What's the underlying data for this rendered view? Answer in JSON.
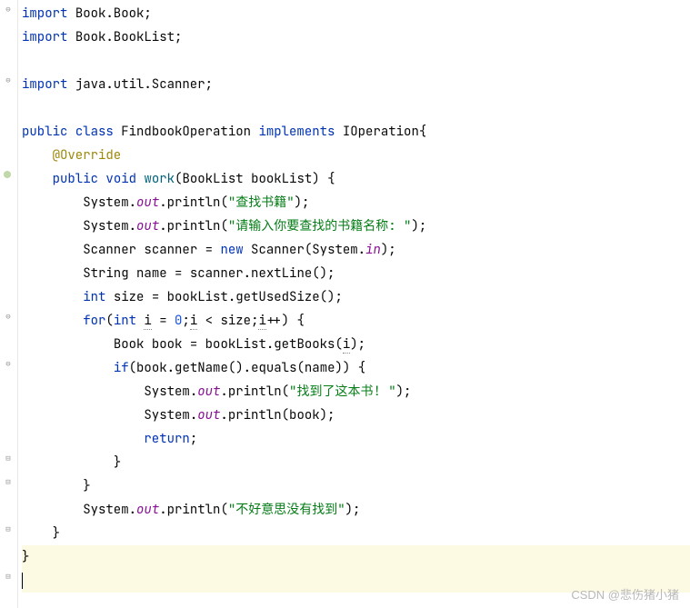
{
  "code": {
    "l1": {
      "import": "import",
      "pkg": "Book.Book",
      "semi": ";"
    },
    "l2": {
      "import": "import",
      "pkg": "Book.BookList",
      "semi": ";"
    },
    "l4": {
      "import": "import",
      "pkg": "java.util.Scanner",
      "semi": ";"
    },
    "l6": {
      "public": "public",
      "class": "class",
      "name": "FindbookOperation",
      "implements": "implements",
      "iface": "IOperation",
      "brace": "{"
    },
    "l7": {
      "ann": "@Override"
    },
    "l8": {
      "public": "public",
      "void": "void",
      "method": "work",
      "lparen": "(",
      "type": "BookList",
      "param": "bookList",
      "rparen": ") {"
    },
    "l9": {
      "sys": "System",
      "dot1": ".",
      "out": "out",
      "dot2": ".",
      "println": "println",
      "lp": "(",
      "str": "\"查找书籍\"",
      "rp": ");"
    },
    "l10": {
      "sys": "System",
      "dot1": ".",
      "out": "out",
      "dot2": ".",
      "println": "println",
      "lp": "(",
      "str": "\"请输入你要查找的书籍名称: \"",
      "rp": ");"
    },
    "l11": {
      "type": "Scanner",
      "var": "scanner",
      "eq": " = ",
      "new": "new",
      "ctor": "Scanner",
      "lp": "(",
      "sys": "System",
      "dot": ".",
      "in": "in",
      "rp": ");"
    },
    "l12": {
      "type": "String",
      "var": "name",
      "eq": " = ",
      "obj": "scanner",
      "dot": ".",
      "method": "nextLine",
      "call": "();"
    },
    "l13": {
      "int": "int",
      "var": "size",
      "eq": " = ",
      "obj": "bookList",
      "dot": ".",
      "method": "getUsedSize",
      "call": "();"
    },
    "l14": {
      "for": "for",
      "lp": "(",
      "int": "int",
      "i1": "i",
      "eq": " = ",
      "zero": "0",
      "semi1": ";",
      "i2": "i",
      "lt": " < ",
      "size": "size",
      "semi2": ";",
      "i3": "i",
      "inc": "++) {"
    },
    "l15": {
      "type": "Book",
      "var": "book",
      "eq": " = ",
      "obj": "bookList",
      "dot": ".",
      "method": "getBooks",
      "lp": "(",
      "i": "i",
      "rp": ");"
    },
    "l16": {
      "if": "if",
      "lp": "(",
      "obj": "book",
      "dot1": ".",
      "m1": "getName",
      "call1": "()",
      "dot2": ".",
      "m2": "equals",
      "lp2": "(",
      "arg": "name",
      "rp": ")) {"
    },
    "l17": {
      "sys": "System",
      "dot1": ".",
      "out": "out",
      "dot2": ".",
      "println": "println",
      "lp": "(",
      "str": "\"找到了这本书! \"",
      "rp": ");"
    },
    "l18": {
      "sys": "System",
      "dot1": ".",
      "out": "out",
      "dot2": ".",
      "println": "println",
      "lp": "(",
      "arg": "book",
      "rp": ");"
    },
    "l19": {
      "return": "return",
      "semi": ";"
    },
    "l20": {
      "brace": "}"
    },
    "l21": {
      "brace": "}"
    },
    "l22": {
      "sys": "System",
      "dot1": ".",
      "out": "out",
      "dot2": ".",
      "println": "println",
      "lp": "(",
      "str": "\"不好意思没有找到\"",
      "rp": ");"
    },
    "l23": {
      "brace": "}"
    },
    "l24": {
      "brace": "}"
    }
  },
  "watermark": "CSDN @悲伤猪小猪"
}
